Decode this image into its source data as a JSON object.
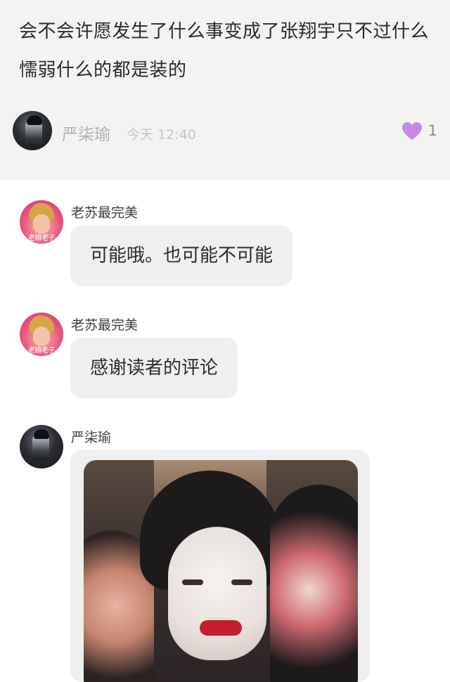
{
  "top_comment": {
    "text": "会不会许愿发生了什么事变成了张翔宇只不过什么懦弱什么的都是装的",
    "author": "严柒瑜",
    "time": "今天 12:40",
    "likes": "1",
    "like_color": "#c58be0"
  },
  "messages": [
    {
      "author": "老苏最完美",
      "avatar_caption": "老娘老子",
      "text": "可能哦。也可能不可能"
    },
    {
      "author": "老苏最完美",
      "avatar_caption": "老娘老子",
      "text": "感谢读者的评论"
    },
    {
      "author": "严柒瑜",
      "type": "image"
    }
  ]
}
